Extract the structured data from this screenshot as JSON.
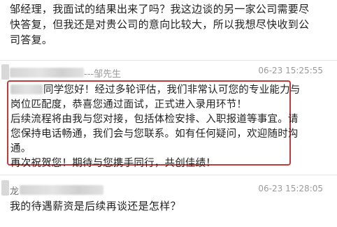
{
  "conversation": {
    "message_top": {
      "lines": [
        "邹经理，我面试的结果出来了吗？我这边谈的另一家公司需要尽",
        "快答复，但我还是对贵公司的意向比较大，所以我想尽快收到公",
        "司答复。"
      ]
    },
    "reply": {
      "sender_suffix": "---邹先生",
      "timestamp": "06-23 15:25:55",
      "lines": [
        "同学您好！经过多轮评估，我们非常认可您的专业能力与",
        "岗位匹配度，恭喜您通过面试，正式进入录用环节！",
        "后续流程将由我与您对接，包括体检安排、入职报道等事宜。请",
        "您保持电话畅通，我们会与您联系。如有任何疑问，欢迎随时沟",
        "通。",
        "再次祝贺您！期待与您携手同行，共创佳绩！"
      ]
    },
    "message_bottom": {
      "sender_initial": "龙",
      "timestamp": "06-23 15:28:05",
      "text": "我的待遇薪资是后续再谈还是怎样？"
    }
  },
  "colors": {
    "highlight_border": "#c0393b",
    "meta_text": "#9a9a9a"
  }
}
